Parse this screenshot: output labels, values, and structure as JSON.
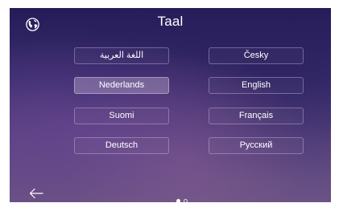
{
  "header": {
    "title": "Taal"
  },
  "languages": [
    {
      "label": "اللغة العربية",
      "selected": false
    },
    {
      "label": "Česky",
      "selected": false
    },
    {
      "label": "Nederlands",
      "selected": true
    },
    {
      "label": "English",
      "selected": false
    },
    {
      "label": "Suomi",
      "selected": false
    },
    {
      "label": "Français",
      "selected": false
    },
    {
      "label": "Deutsch",
      "selected": false
    },
    {
      "label": "Русский",
      "selected": false
    }
  ],
  "pagination": {
    "current_page": 1,
    "total_pages": 2
  },
  "icons": {
    "top_left": "globe-icon",
    "bottom_left": "back-arrow-icon"
  },
  "colors": {
    "background_top": "#241c58",
    "background_bottom": "#6a5284",
    "text": "#ffffff"
  }
}
